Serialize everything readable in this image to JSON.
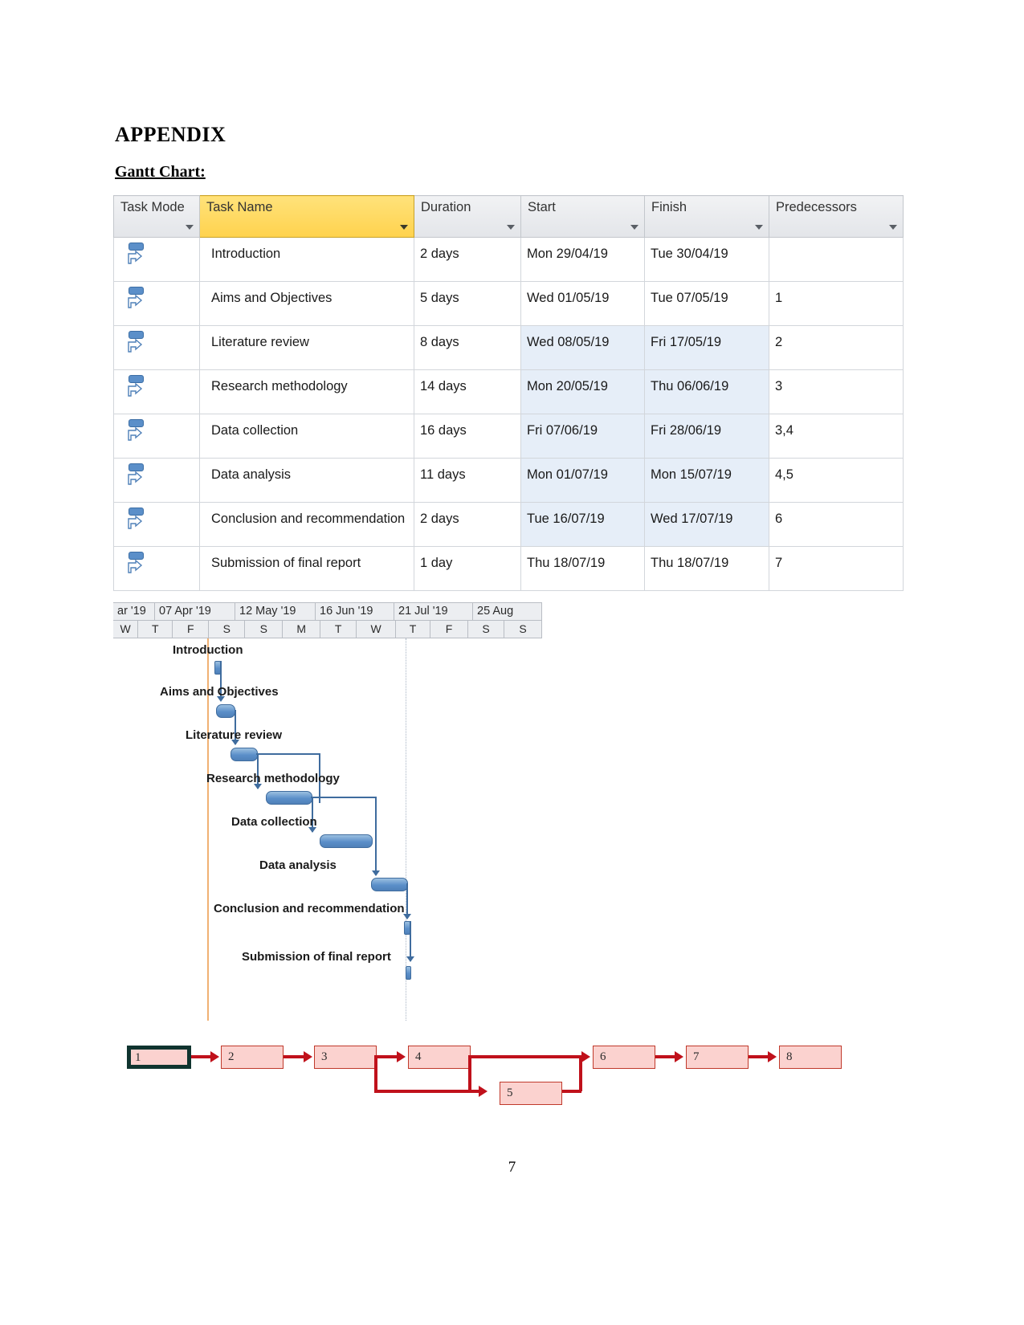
{
  "document": {
    "appendix_title": "APPENDIX",
    "section_heading": "Gantt Chart:",
    "page_number": "7"
  },
  "table": {
    "columns": [
      {
        "label": "Task Mode",
        "key": "mode"
      },
      {
        "label": "Task Name",
        "key": "name"
      },
      {
        "label": "Duration",
        "key": "duration"
      },
      {
        "label": "Start",
        "key": "start"
      },
      {
        "label": "Finish",
        "key": "finish"
      },
      {
        "label": "Predecessors",
        "key": "predecessors"
      }
    ],
    "rows": [
      {
        "id": 1,
        "mode_icon": "auto-schedule-icon",
        "name": "Introduction",
        "duration": "2 days",
        "start": "Mon 29/04/19",
        "finish": "Tue 30/04/19",
        "predecessors": ""
      },
      {
        "id": 2,
        "mode_icon": "auto-schedule-icon",
        "name": "Aims and Objectives",
        "duration": "5 days",
        "start": "Wed 01/05/19",
        "finish": "Tue 07/05/19",
        "predecessors": "1"
      },
      {
        "id": 3,
        "mode_icon": "auto-schedule-icon",
        "name": "Literature review",
        "duration": "8 days",
        "start": "Wed 08/05/19",
        "finish": "Fri 17/05/19",
        "predecessors": "2"
      },
      {
        "id": 4,
        "mode_icon": "auto-schedule-icon",
        "name": "Research methodology",
        "duration": "14 days",
        "start": "Mon 20/05/19",
        "finish": "Thu 06/06/19",
        "predecessors": "3"
      },
      {
        "id": 5,
        "mode_icon": "auto-schedule-icon",
        "name": "Data collection",
        "duration": "16 days",
        "start": "Fri 07/06/19",
        "finish": "Fri 28/06/19",
        "predecessors": "3,4"
      },
      {
        "id": 6,
        "mode_icon": "auto-schedule-icon",
        "name": "Data analysis",
        "duration": "11 days",
        "start": "Mon 01/07/19",
        "finish": "Mon 15/07/19",
        "predecessors": "4,5"
      },
      {
        "id": 7,
        "mode_icon": "auto-schedule-icon",
        "name": "Conclusion and recommendation",
        "duration": "2 days",
        "start": "Tue 16/07/19",
        "finish": "Wed 17/07/19",
        "predecessors": "6"
      },
      {
        "id": 8,
        "mode_icon": "auto-schedule-icon",
        "name": "Submission of final report",
        "duration": "1 day",
        "start": "Thu 18/07/19",
        "finish": "Thu 18/07/19",
        "predecessors": "7"
      }
    ]
  },
  "chart_data": {
    "type": "bar",
    "chart_kind": "gantt",
    "title": "Gantt Chart:",
    "timeline_header": {
      "months": [
        "ar '19",
        "07 Apr '19",
        "12 May '19",
        "16 Jun '19",
        "21 Jul '19",
        "25 Aug"
      ],
      "days": [
        "W",
        "T",
        "F",
        "S",
        "S",
        "M",
        "T",
        "W",
        "T",
        "F",
        "S",
        "S"
      ]
    },
    "categories": [
      "Introduction",
      "Aims and Objectives",
      "Literature review",
      "Research methodology",
      "Data collection",
      "Data analysis",
      "Conclusion and recommendation",
      "Submission of final report"
    ],
    "tasks": [
      {
        "name": "Introduction",
        "duration_days": 2,
        "start": "Mon 29/04/19",
        "finish": "Tue 30/04/19",
        "predecessors": []
      },
      {
        "name": "Aims and Objectives",
        "duration_days": 5,
        "start": "Wed 01/05/19",
        "finish": "Tue 07/05/19",
        "predecessors": [
          1
        ]
      },
      {
        "name": "Literature review",
        "duration_days": 8,
        "start": "Wed 08/05/19",
        "finish": "Fri 17/05/19",
        "predecessors": [
          2
        ]
      },
      {
        "name": "Research methodology",
        "duration_days": 14,
        "start": "Mon 20/05/19",
        "finish": "Thu 06/06/19",
        "predecessors": [
          3
        ]
      },
      {
        "name": "Data collection",
        "duration_days": 16,
        "start": "Fri 07/06/19",
        "finish": "Fri 28/06/19",
        "predecessors": [
          3,
          4
        ]
      },
      {
        "name": "Data analysis",
        "duration_days": 11,
        "start": "Mon 01/07/19",
        "finish": "Mon 15/07/19",
        "predecessors": [
          4,
          5
        ]
      },
      {
        "name": "Conclusion and recommendation",
        "duration_days": 2,
        "start": "Tue 16/07/19",
        "finish": "Wed 17/07/19",
        "predecessors": [
          6
        ]
      },
      {
        "name": "Submission of final report",
        "duration_days": 1,
        "start": "Thu 18/07/19",
        "finish": "Thu 18/07/19",
        "predecessors": [
          7
        ]
      }
    ],
    "values": [
      2,
      5,
      8,
      14,
      16,
      11,
      2,
      1
    ],
    "xlabel": "",
    "ylabel": "",
    "legend": [],
    "grid": false,
    "colors": {
      "bar_fill": "#5b8fc9",
      "bar_border": "#3f6c9e",
      "today_line": "#f0b173",
      "header_highlight": "#ffd24d",
      "network_node_fill": "#fbd2cf",
      "network_edge": "#c0111b"
    }
  },
  "network": {
    "nodes": [
      {
        "id": "1",
        "label": "1"
      },
      {
        "id": "2",
        "label": "2"
      },
      {
        "id": "3",
        "label": "3"
      },
      {
        "id": "4",
        "label": "4"
      },
      {
        "id": "5",
        "label": "5"
      },
      {
        "id": "6",
        "label": "6"
      },
      {
        "id": "7",
        "label": "7"
      },
      {
        "id": "8",
        "label": "8"
      }
    ],
    "edges": [
      [
        "1",
        "2"
      ],
      [
        "2",
        "3"
      ],
      [
        "3",
        "4"
      ],
      [
        "3",
        "5"
      ],
      [
        "4",
        "5"
      ],
      [
        "4",
        "6"
      ],
      [
        "5",
        "6"
      ],
      [
        "6",
        "7"
      ],
      [
        "7",
        "8"
      ]
    ]
  }
}
